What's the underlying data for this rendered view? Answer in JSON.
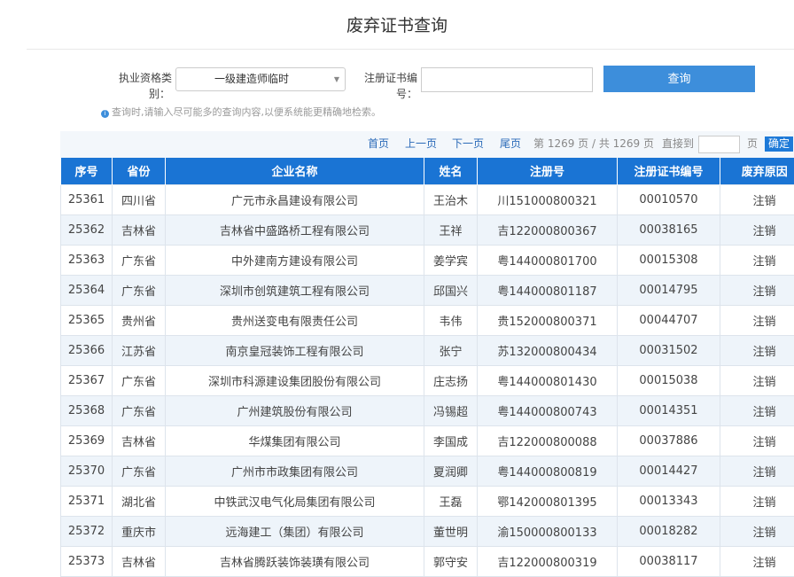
{
  "title": "废弃证书查询",
  "form": {
    "type_label_1": "执业资格类",
    "type_label_2": "别：",
    "type_value": "一级建造师临时",
    "cert_label_1": "注册证书编",
    "cert_label_2": "号：",
    "cert_value": "",
    "query_button": "查询",
    "hint": "查询时,请输入尽可能多的查询内容,以便系统能更精确地检索。"
  },
  "pager": {
    "first": "首页",
    "prev": "上一页",
    "next": "下一页",
    "last": "尾页",
    "status": "第 1269 页 / 共 1269 页",
    "goto": "直接到",
    "page_unit": "页",
    "confirm": "确定"
  },
  "table": {
    "headers": [
      "序号",
      "省份",
      "企业名称",
      "姓名",
      "注册号",
      "注册证书编号",
      "废弃原因"
    ],
    "rows": [
      [
        "25361",
        "四川省",
        "广元市永昌建设有限公司",
        "王治木",
        "川151000800321",
        "00010570",
        "注销"
      ],
      [
        "25362",
        "吉林省",
        "吉林省中盛路桥工程有限公司",
        "王祥",
        "吉122000800367",
        "00038165",
        "注销"
      ],
      [
        "25363",
        "广东省",
        "中外建南方建设有限公司",
        "姜学宾",
        "粤144000801700",
        "00015308",
        "注销"
      ],
      [
        "25364",
        "广东省",
        "深圳市创筑建筑工程有限公司",
        "邱国兴",
        "粤144000801187",
        "00014795",
        "注销"
      ],
      [
        "25365",
        "贵州省",
        "贵州送变电有限责任公司",
        "韦伟",
        "贵152000800371",
        "00044707",
        "注销"
      ],
      [
        "25366",
        "江苏省",
        "南京皇冠装饰工程有限公司",
        "张宁",
        "苏132000800434",
        "00031502",
        "注销"
      ],
      [
        "25367",
        "广东省",
        "深圳市科源建设集团股份有限公司",
        "庄志扬",
        "粤144000801430",
        "00015038",
        "注销"
      ],
      [
        "25368",
        "广东省",
        "广州建筑股份有限公司",
        "冯锡超",
        "粤144000800743",
        "00014351",
        "注销"
      ],
      [
        "25369",
        "吉林省",
        "华煤集团有限公司",
        "李国成",
        "吉122000800088",
        "00037886",
        "注销"
      ],
      [
        "25370",
        "广东省",
        "广州市市政集团有限公司",
        "夏润卿",
        "粤144000800819",
        "00014427",
        "注销"
      ],
      [
        "25371",
        "湖北省",
        "中铁武汉电气化局集团有限公司",
        "王磊",
        "鄂142000801395",
        "00013343",
        "注销"
      ],
      [
        "25372",
        "重庆市",
        "远海建工（集团）有限公司",
        "董世明",
        "渝150000800133",
        "00018282",
        "注销"
      ],
      [
        "25373",
        "吉林省",
        "吉林省腾跃装饰装璜有限公司",
        "郭守安",
        "吉122000800319",
        "00038117",
        "注销"
      ]
    ]
  }
}
